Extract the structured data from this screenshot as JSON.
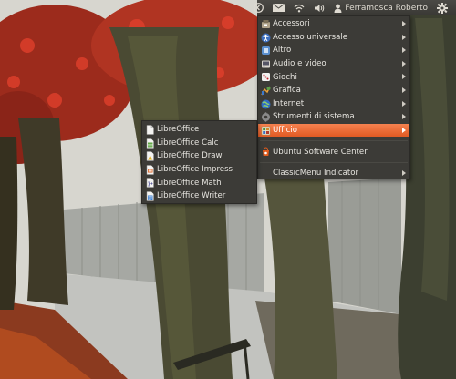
{
  "panel": {
    "user_name": "Ferramosca Roberto"
  },
  "main_menu": {
    "items": [
      {
        "label": "Accessori",
        "icon": "accessories-icon",
        "submenu": true
      },
      {
        "label": "Accesso universale",
        "icon": "universal-access-icon",
        "submenu": true
      },
      {
        "label": "Altro",
        "icon": "other-icon",
        "submenu": true
      },
      {
        "label": "Audio e video",
        "icon": "audio-video-icon",
        "submenu": true
      },
      {
        "label": "Giochi",
        "icon": "games-icon",
        "submenu": true
      },
      {
        "label": "Grafica",
        "icon": "graphics-icon",
        "submenu": true
      },
      {
        "label": "Internet",
        "icon": "internet-icon",
        "submenu": true
      },
      {
        "label": "Strumenti di sistema",
        "icon": "system-tools-icon",
        "submenu": true
      },
      {
        "label": "Ufficio",
        "icon": "office-icon",
        "submenu": true,
        "highlighted": true
      }
    ],
    "software_center": "Ubuntu Software Center",
    "classicmenu": "ClassicMenu Indicator"
  },
  "office_submenu": {
    "items": [
      {
        "label": "LibreOffice",
        "icon": "libreoffice-icon"
      },
      {
        "label": "LibreOffice Calc",
        "icon": "libreoffice-calc-icon"
      },
      {
        "label": "LibreOffice Draw",
        "icon": "libreoffice-draw-icon"
      },
      {
        "label": "LibreOffice Impress",
        "icon": "libreoffice-impress-icon"
      },
      {
        "label": "LibreOffice Math",
        "icon": "libreoffice-math-icon"
      },
      {
        "label": "LibreOffice Writer",
        "icon": "libreoffice-writer-icon"
      }
    ]
  },
  "colors": {
    "highlight": "#e8632c",
    "menu_bg": "#3c3b37",
    "panel_bg": "#3c3b37"
  }
}
